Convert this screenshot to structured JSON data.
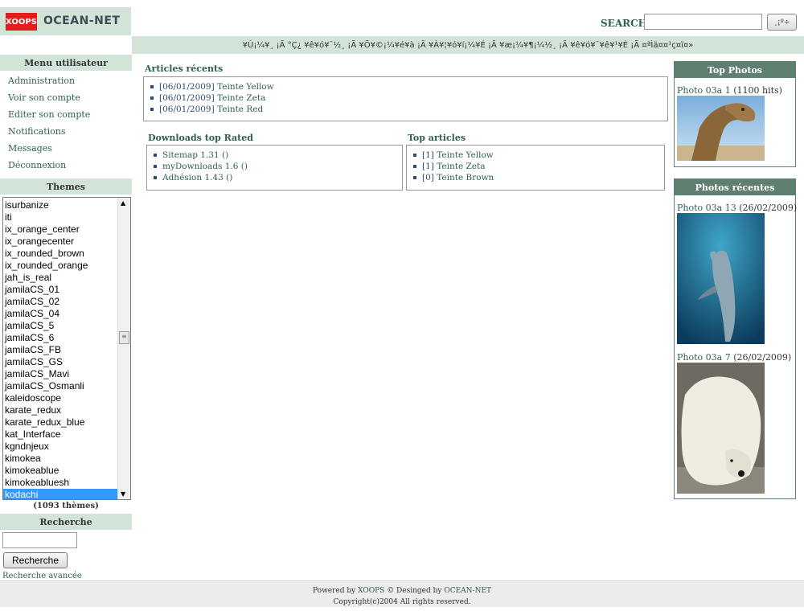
{
  "header": {
    "logo_badge": "XOOPS",
    "logo_text": "OCEAN-NET",
    "search_label": "SEARCH",
    "search_button_label": "¸¡º÷",
    "brand_color": "#e21d1d",
    "accent_color": "#d2e3d8"
  },
  "nav": {
    "text": "¥Ú¡¼¥¸ ¡Ã °Ç¿ ¥ê¥ó¥¯½¸ ¡Ã ¥Õ¥©¡¼¥é¥à ¡Ã ¥À¥¦¥ó¥í¡¼¥É ¡Ã ¥æ¡¼¥¶¡¼½¸ ¡Ã ¥ê¥ó¥¯¥ê¥¹¥È ¡Ã ¤ªÌä¤¤¹ç¤ï¤»"
  },
  "user_menu": {
    "title": "Menu utilisateur",
    "items": [
      "Administration",
      "Voir son compte",
      "Editer son compte",
      "Notifications",
      "Messages",
      "Déconnexion"
    ]
  },
  "themes": {
    "title": "Themes",
    "items": [
      "isurbanize",
      "iti",
      "ix_orange_center",
      "ix_orangecenter",
      "ix_rounded_brown",
      "ix_rounded_orange",
      "jah_is_real",
      "jamilaCS_01",
      "jamilaCS_02",
      "jamilaCS_04",
      "jamilaCS_5",
      "jamilaCS_6",
      "jamilaCS_FB",
      "jamilaCS_GS",
      "jamilaCS_Mavi",
      "jamilaCS_Osmanli",
      "kaleidoscope",
      "karate_redux",
      "karate_redux_blue",
      "kat_Interface",
      "kgndnjeux",
      "kimokea",
      "kimokeablue",
      "kimokeabluesh",
      "kodachi"
    ],
    "selected": "kodachi",
    "count_prefix": "(",
    "count": "1093",
    "count_suffix": " thèmes)"
  },
  "recherche": {
    "title": "Recherche",
    "button_label": "Recherche",
    "advanced_label": "Recherche avancée"
  },
  "articles_recents": {
    "title": "Articles récents",
    "items": [
      {
        "date": "[06/01/2009]",
        "label": "Teinte Yellow"
      },
      {
        "date": "[06/01/2009]",
        "label": "Teinte Zeta"
      },
      {
        "date": "[06/01/2009]",
        "label": "Teinte Red"
      }
    ]
  },
  "downloads_top": {
    "title": "Downloads top Rated",
    "items": [
      "Sitemap 1.31 ()",
      "myDownloads 1.6 ()",
      "Adhésion 1.43 ()"
    ]
  },
  "top_articles": {
    "title": "Top articles",
    "items": [
      {
        "rank": "[1]",
        "label": "Teinte Yellow"
      },
      {
        "rank": "[1]",
        "label": "Teinte Zeta"
      },
      {
        "rank": "[0]",
        "label": "Teinte Brown"
      }
    ]
  },
  "top_photos": {
    "title": "Top Photos",
    "items": [
      {
        "link": "Photo 03a 1",
        "info": " (1100 hits)",
        "icon": "camel-photo"
      }
    ]
  },
  "photos_recentes": {
    "title": "Photos récentes",
    "items": [
      {
        "link": "Photo 03a 13",
        "info": " (26/02/2009)",
        "icon": "dolphin-photo"
      },
      {
        "link": "Photo 03a 7",
        "info": " (26/02/2009)",
        "icon": "polar-bear-photo"
      }
    ]
  },
  "footer": {
    "powered_by": "Powered by ",
    "xoops_link": "XOOPS",
    "separator": " © Desinged by ",
    "oceannet_link": "OCEAN-NET",
    "copyright": "Copyright(c)2004 All rights reserved."
  }
}
